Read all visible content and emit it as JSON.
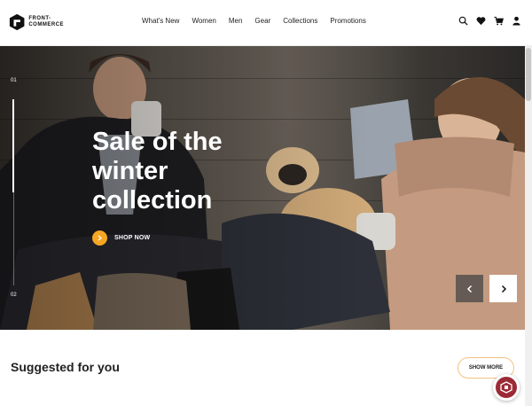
{
  "brand": {
    "name_line1": "FRONT-",
    "name_line2": "COMMERCE"
  },
  "nav": {
    "items": [
      {
        "label": "What's New"
      },
      {
        "label": "Women"
      },
      {
        "label": "Men"
      },
      {
        "label": "Gear"
      },
      {
        "label": "Collections"
      },
      {
        "label": "Promotions"
      }
    ]
  },
  "header_actions": [
    "search-icon",
    "heart-icon",
    "cart-icon",
    "user-icon"
  ],
  "hero": {
    "slide_current": "01",
    "slide_next": "02",
    "progress": 0.5,
    "title": "Sale of the winter collection",
    "cta_label": "SHOP NOW",
    "accent_color": "#f5a623"
  },
  "suggested": {
    "title": "Suggested for you",
    "show_more_label": "SHOW MORE"
  },
  "chat": {
    "color": "#9c2a36"
  }
}
